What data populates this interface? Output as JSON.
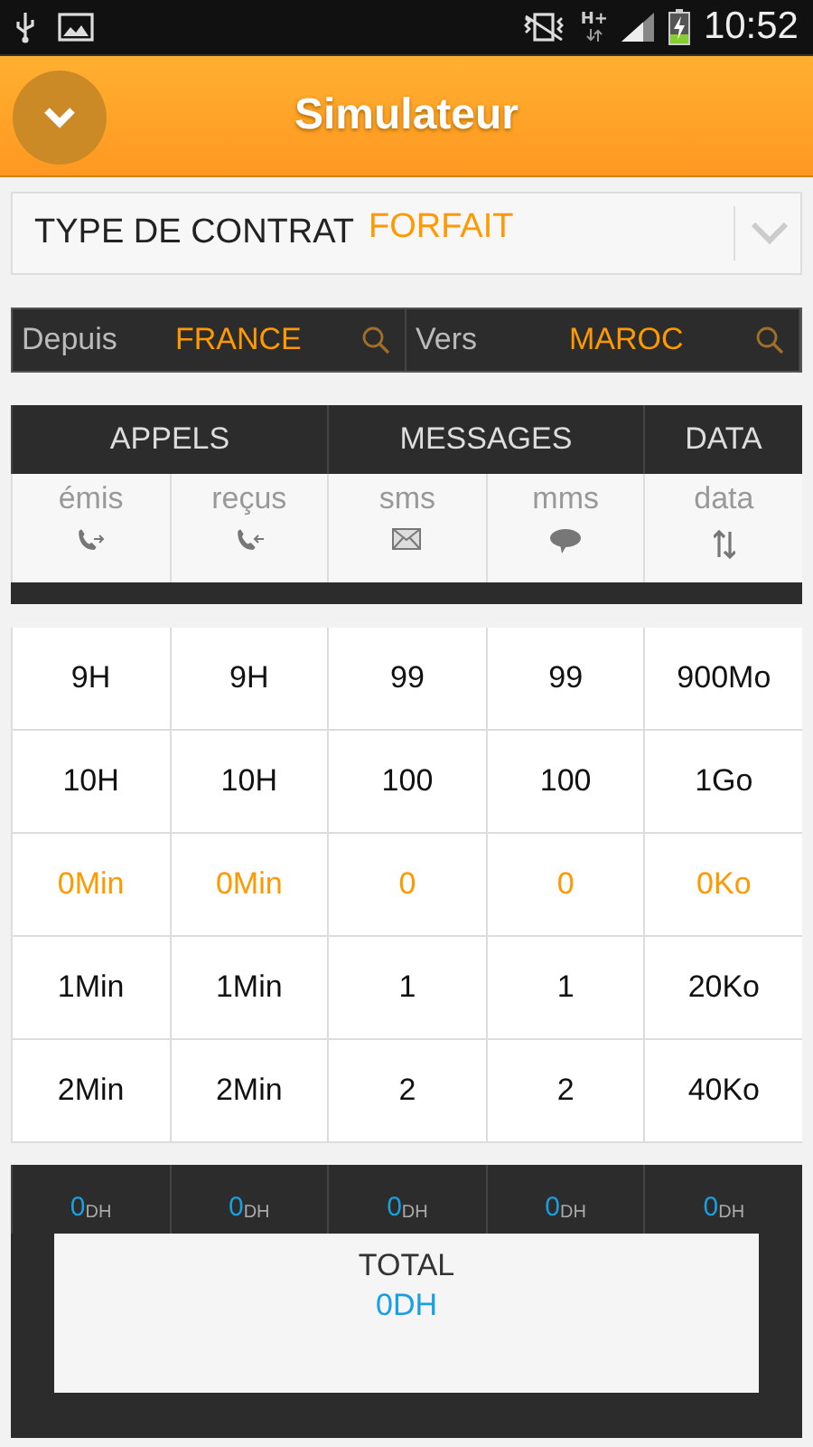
{
  "status_bar": {
    "network": "H+",
    "time": "10:52"
  },
  "header": {
    "title": "Simulateur"
  },
  "contract": {
    "label": "TYPE DE CONTRAT",
    "value": "FORFAIT"
  },
  "route": {
    "from_label": "Depuis",
    "from_value": "FRANCE",
    "to_label": "Vers",
    "to_value": "MAROC"
  },
  "groups": [
    {
      "label": "APPELS",
      "columns": [
        {
          "label": "émis",
          "kind": "call-out"
        },
        {
          "label": "reçus",
          "kind": "call-in"
        }
      ]
    },
    {
      "label": "MESSAGES",
      "columns": [
        {
          "label": "sms",
          "kind": "sms"
        },
        {
          "label": "mms",
          "kind": "mms"
        }
      ]
    },
    {
      "label": "DATA",
      "columns": [
        {
          "label": "data",
          "kind": "data"
        }
      ]
    }
  ],
  "rows": [
    {
      "cells": [
        "9H",
        "9H",
        "99",
        "99",
        "900Mo"
      ],
      "selected": false
    },
    {
      "cells": [
        "10H",
        "10H",
        "100",
        "100",
        "1Go"
      ],
      "selected": false
    },
    {
      "cells": [
        "0Min",
        "0Min",
        "0",
        "0",
        "0Ko"
      ],
      "selected": true
    },
    {
      "cells": [
        "1Min",
        "1Min",
        "1",
        "1",
        "20Ko"
      ],
      "selected": false
    },
    {
      "cells": [
        "2Min",
        "2Min",
        "2",
        "2",
        "40Ko"
      ],
      "selected": false
    }
  ],
  "costs": [
    {
      "value": "0",
      "unit": "DH"
    },
    {
      "value": "0",
      "unit": "DH"
    },
    {
      "value": "0",
      "unit": "DH"
    },
    {
      "value": "0",
      "unit": "DH"
    },
    {
      "value": "0",
      "unit": "DH"
    }
  ],
  "total": {
    "label": "TOTAL",
    "value": "0DH"
  }
}
